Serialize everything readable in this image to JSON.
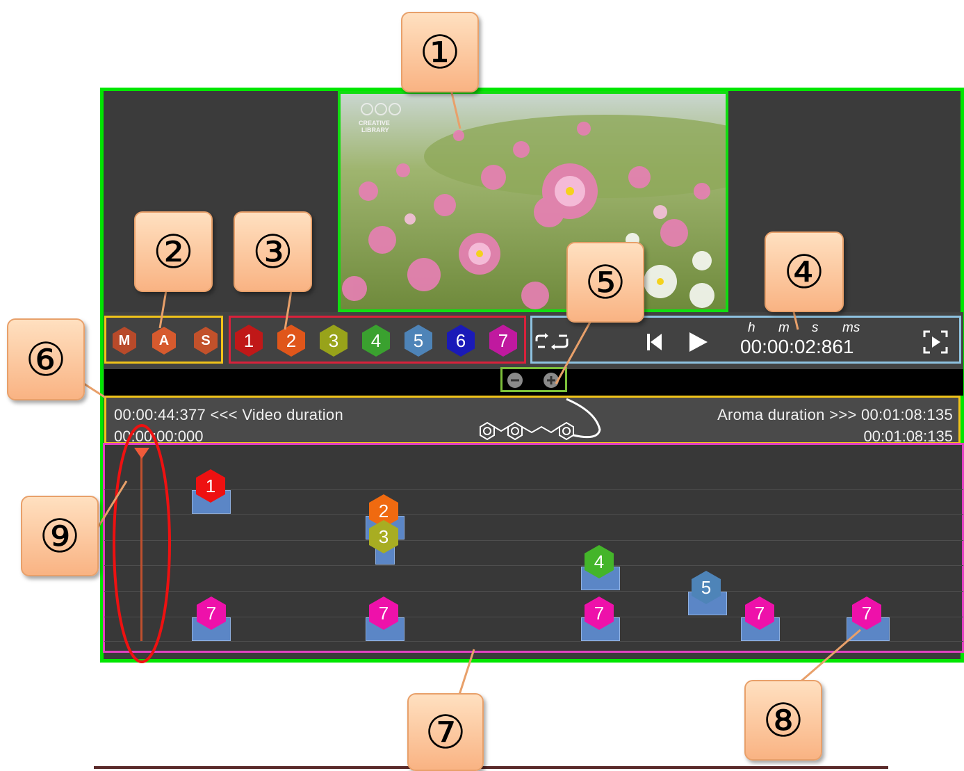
{
  "callouts": [
    "①",
    "②",
    "③",
    "④",
    "⑤",
    "⑥",
    "⑦",
    "⑧",
    "⑨"
  ],
  "video_logo": [
    "CREATIVE",
    "LIBRARY"
  ],
  "mode_buttons": [
    "M",
    "A",
    "S"
  ],
  "scent_buttons": [
    {
      "label": "1",
      "color": "#c01818"
    },
    {
      "label": "2",
      "color": "#e0561a"
    },
    {
      "label": "3",
      "color": "#98a31a"
    },
    {
      "label": "4",
      "color": "#3aa12f"
    },
    {
      "label": "5",
      "color": "#4e84b8"
    },
    {
      "label": "6",
      "color": "#1a1ab8"
    },
    {
      "label": "7",
      "color": "#c0199f"
    }
  ],
  "controls": {
    "loop_icon": "loop-icon",
    "prev_icon": "skip-back-icon",
    "play_icon": "play-icon",
    "fullscreen_icon": "fullscreen-icon",
    "time_units": [
      "h",
      "m",
      "s",
      "ms"
    ],
    "time": "00:00:02:861"
  },
  "zoom": {
    "out_icon": "zoom-out-icon",
    "in_icon": "zoom-in-icon"
  },
  "durations": {
    "video_line": "00:00:44:377 <<< Video duration",
    "video_current": "00:00:00:000",
    "aroma_line": "Aroma duration >>> 00:01:08:135",
    "aroma_current": "00:01:08:135"
  },
  "timeline_markers": [
    {
      "label": "1",
      "color": "#ee1111"
    },
    {
      "label": "2",
      "color": "#f06a10"
    },
    {
      "label": "3",
      "color": "#a8ad22"
    },
    {
      "label": "4",
      "color": "#44b52a"
    },
    {
      "label": "5",
      "color": "#4e84b8"
    },
    {
      "label": "7",
      "color": "#ee11aa"
    },
    {
      "label": "7",
      "color": "#ee11aa"
    },
    {
      "label": "7",
      "color": "#ee11aa"
    },
    {
      "label": "7",
      "color": "#ee11aa"
    },
    {
      "label": "7",
      "color": "#ee11aa"
    }
  ]
}
